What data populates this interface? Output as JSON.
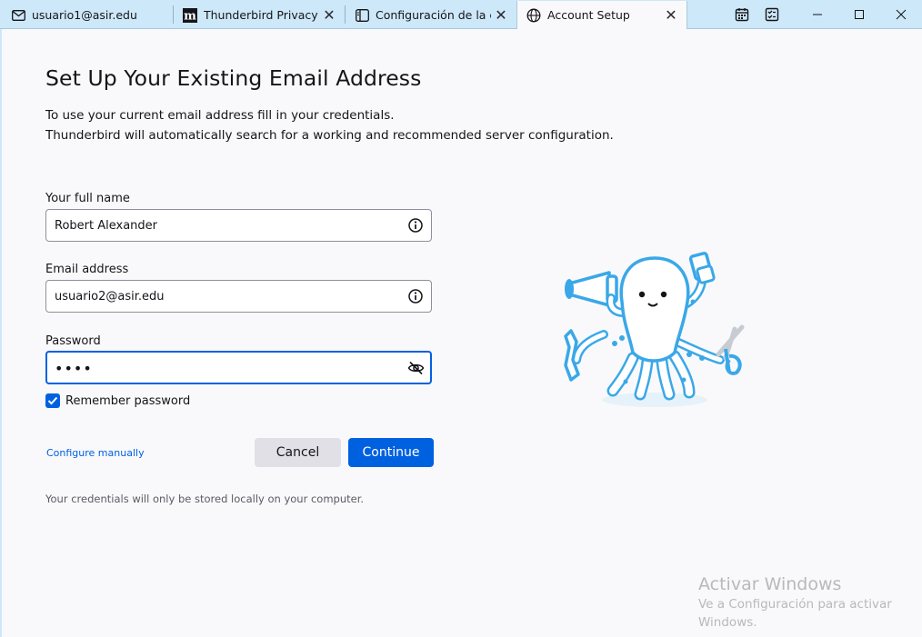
{
  "tabs": [
    {
      "label": "usuario1@asir.edu",
      "icon": "mail-icon"
    },
    {
      "label": "Thunderbird Privacy Notice",
      "icon": "mozilla-m-icon"
    },
    {
      "label": "Configuración de la cuenta",
      "icon": "account-settings-icon"
    },
    {
      "label": "Account Setup",
      "icon": "globe-icon",
      "active": true
    }
  ],
  "window_controls": {
    "icons": [
      "calendar-icon",
      "tasks-icon",
      "minimize-icon",
      "maximize-icon",
      "close-icon"
    ]
  },
  "setup": {
    "title": "Set Up Your Existing Email Address",
    "description_line1": "To use your current email address fill in your credentials.",
    "description_line2": "Thunderbird will automatically search for a working and recommended server configuration.",
    "name_label": "Your full name",
    "name_value": "Robert Alexander",
    "email_label": "Email address",
    "email_value": "usuario2@asir.edu",
    "password_label": "Password",
    "password_value": "••••",
    "remember_label": "Remember password",
    "remember_checked": true,
    "configure_manually": "Configure manually",
    "cancel_label": "Cancel",
    "continue_label": "Continue",
    "note": "Your credentials will only be stored locally on your computer."
  },
  "watermark": {
    "title": "Activar Windows",
    "line1": "Ve a Configuración para activar",
    "line2": "Windows."
  },
  "colors": {
    "accent": "#0061e0",
    "titlebar": "#cde8f8",
    "mascot": "#3aa8e8"
  }
}
